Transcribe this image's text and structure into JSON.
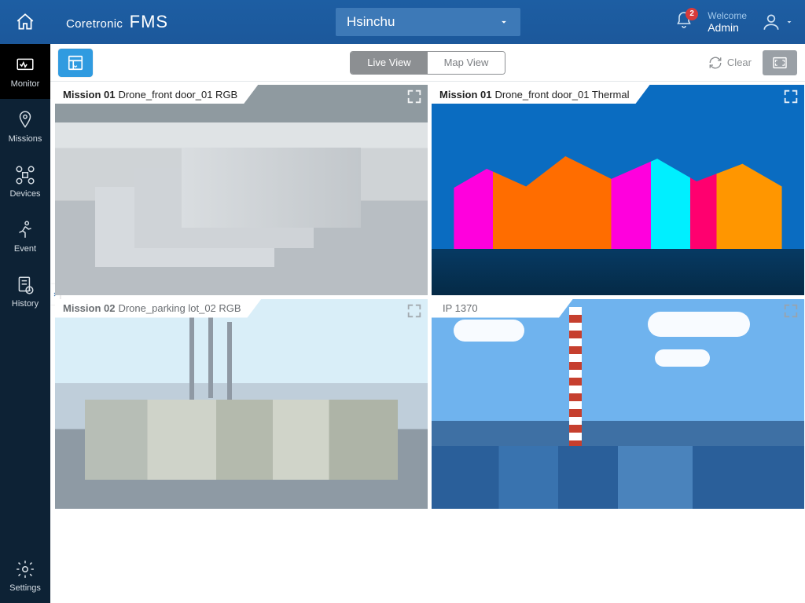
{
  "header": {
    "brand_prefix": "Coretronic",
    "brand_suffix": "FMS",
    "site": "Hsinchu",
    "notif_count": "2",
    "welcome_label": "Welcome",
    "username": "Admin"
  },
  "sidebar": {
    "items": [
      {
        "label": "Monitor",
        "icon": "monitor"
      },
      {
        "label": "Missions",
        "icon": "missions"
      },
      {
        "label": "Devices",
        "icon": "drone"
      },
      {
        "label": "Event",
        "icon": "event"
      },
      {
        "label": "History",
        "icon": "history"
      }
    ],
    "settings_label": "Settings"
  },
  "toolbar": {
    "live_label": "Live View",
    "map_label": "Map View",
    "clear_label": "Clear"
  },
  "feeds": [
    {
      "mission": "Mission 01",
      "title": "Drone_front door_01 RGB",
      "scene": "roof",
      "active": true
    },
    {
      "mission": "Mission 01",
      "title": "Drone_front door_01 Thermal",
      "scene": "thermal",
      "active": true
    },
    {
      "mission": "Mission 02",
      "title": "Drone_parking lot_02 RGB",
      "scene": "city",
      "active": false
    },
    {
      "mission": "",
      "title": "IP 1370",
      "scene": "plant",
      "active": false
    }
  ]
}
